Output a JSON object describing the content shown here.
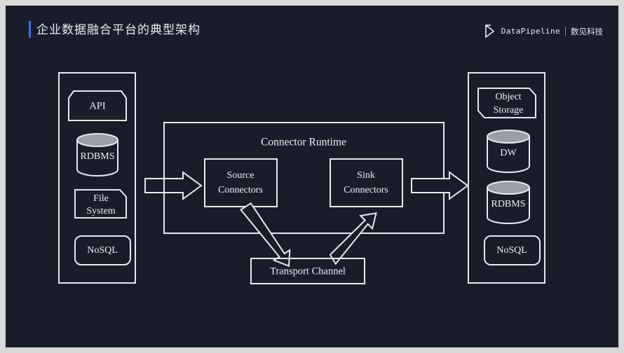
{
  "header": {
    "title": "企业数据融合平台的典型架构",
    "accent_color": "#3d6ff5",
    "brand_name": "DataPipeline",
    "brand_cn": "数见科技",
    "brand_icon": "play-bracket-icon"
  },
  "theme": {
    "page_background": "#d9d9da",
    "slide_background": "#191d2a",
    "stroke": "#e7e9ee",
    "text": "#eef0f4",
    "cylinder_top_fill": "#9a9ea8"
  },
  "diagram": {
    "type": "architecture-flow",
    "source_panel": {
      "name": "data-sources-panel",
      "nodes": [
        {
          "label": "API",
          "shape": "chamfered-top-box"
        },
        {
          "label": "RDBMS",
          "shape": "cylinder"
        },
        {
          "label": "File System",
          "line1": "File",
          "line2": "System",
          "shape": "chamfered-corner-box"
        },
        {
          "label": "NoSQL",
          "shape": "rounded-box"
        }
      ]
    },
    "runtime": {
      "title": "Connector Runtime",
      "nodes": [
        {
          "label": "Source Connectors",
          "line1": "Source",
          "line2": "Connectors",
          "shape": "rect"
        },
        {
          "label": "Sink Connectors",
          "line1": "Sink",
          "line2": "Connectors",
          "shape": "rect"
        }
      ]
    },
    "transport": {
      "label": "Transport Channel",
      "shape": "rect"
    },
    "target_panel": {
      "name": "data-targets-panel",
      "nodes": [
        {
          "label": "Object Storage",
          "line1": "Object",
          "line2": "Storage",
          "shape": "chamfered-corner-box"
        },
        {
          "label": "DW",
          "shape": "cylinder"
        },
        {
          "label": "RDBMS",
          "shape": "cylinder"
        },
        {
          "label": "NoSQL",
          "shape": "rounded-box"
        }
      ]
    },
    "connectors": [
      {
        "name": "sources-to-runtime-arrow",
        "direction": "right",
        "style": "hollow-block"
      },
      {
        "name": "runtime-to-targets-arrow",
        "direction": "right",
        "style": "hollow-block"
      },
      {
        "name": "source-connectors-to-transport-arrow",
        "direction": "down-right",
        "style": "hollow-block"
      },
      {
        "name": "transport-to-sink-connectors-arrow",
        "direction": "up-right",
        "style": "hollow-block"
      }
    ]
  }
}
